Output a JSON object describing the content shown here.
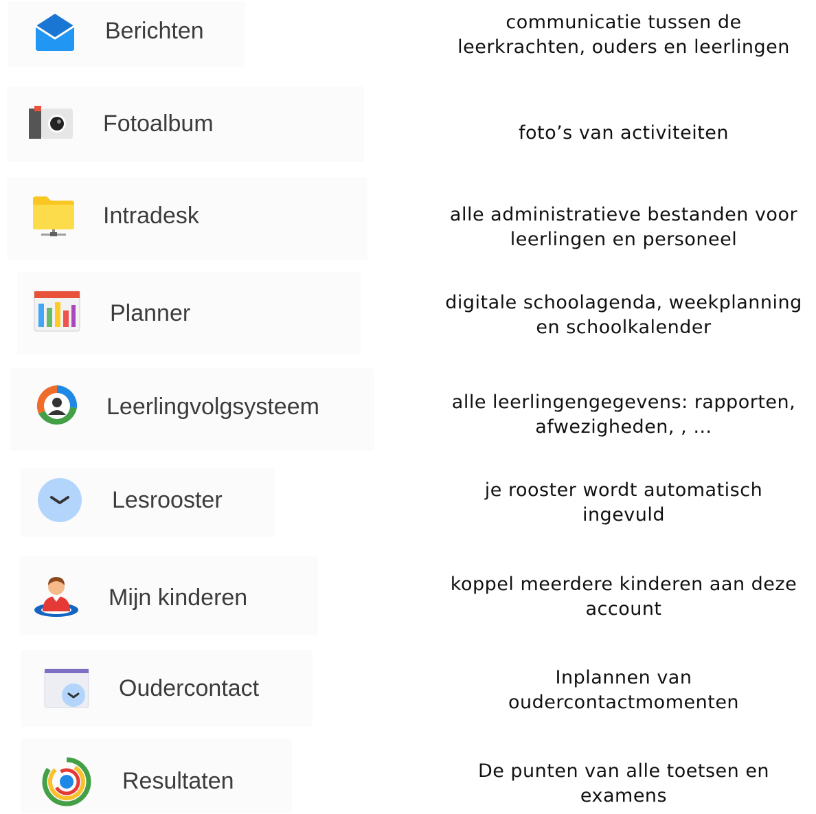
{
  "apps": [
    {
      "id": "berichten",
      "label": "Berichten",
      "icon": "envelope-icon",
      "description": [
        "communicatie tussen de",
        "leerkrachten, ouders  en leerlingen"
      ]
    },
    {
      "id": "fotoalbum",
      "label": "Fotoalbum",
      "icon": "camera-icon",
      "description": [
        "foto’s van activiteiten"
      ]
    },
    {
      "id": "intradesk",
      "label": "Intradesk",
      "icon": "network-folder-icon",
      "description": [
        "alle administratieve bestanden voor",
        "leerlingen en personeel"
      ]
    },
    {
      "id": "planner",
      "label": "Planner",
      "icon": "planner-calendar-icon",
      "description": [
        "digitale schoolagenda, weekplanning",
        "en schoolkalender"
      ]
    },
    {
      "id": "leerlingvolgsysteem",
      "label": "Leerlingvolgsysteem",
      "icon": "student-tracking-icon",
      "description": [
        "alle leerlingengegevens: rapporten,",
        "afwezigheden, , …"
      ]
    },
    {
      "id": "lesrooster",
      "label": "Lesrooster",
      "icon": "clock-icon",
      "description": [
        "je rooster wordt automatisch",
        "ingevuld"
      ]
    },
    {
      "id": "mijn-kinderen",
      "label": "Mijn kinderen",
      "icon": "child-profile-icon",
      "description": [
        "koppel meerdere kinderen aan deze",
        "account"
      ]
    },
    {
      "id": "oudercontact",
      "label": "Oudercontact",
      "icon": "calendar-clock-icon",
      "description": [
        "Inplannen van",
        "oudercontactmomenten"
      ]
    },
    {
      "id": "resultaten",
      "label": "Resultaten",
      "icon": "results-rings-icon",
      "description": [
        "De punten van alle toetsen en",
        "examens"
      ]
    }
  ],
  "colors": {
    "envelope": "#1e88e5",
    "folder": "#fbc02d",
    "planner_header": "#e8513a",
    "clock_face": "#b3d4fb",
    "text": "#111111",
    "label": "#3c3c3c"
  }
}
